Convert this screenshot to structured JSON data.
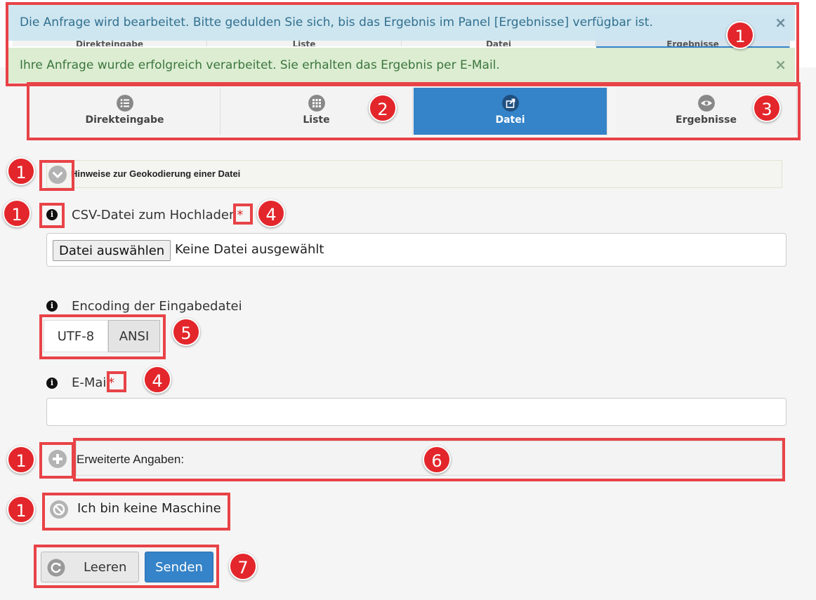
{
  "alerts": {
    "info": "Die Anfrage wird bearbeitet. Bitte gedulden Sie sich, bis das Ergebnis im Panel [Ergebnisse] verfügbar ist.",
    "success": "Ihre Anfrage wurde erfolgreich verarbeitet. Sie erhalten das Ergebnis per E-Mail.",
    "close_glyph": "×"
  },
  "tabs": [
    {
      "label": "Direkteingabe",
      "icon": "list-icon"
    },
    {
      "label": "Liste",
      "icon": "grid-icon"
    },
    {
      "label": "Datei",
      "icon": "share-icon",
      "active": true
    },
    {
      "label": "Ergebnisse",
      "icon": "eye-icon"
    }
  ],
  "hint": {
    "label": "Hinweise zur Geokodierung einer Datei"
  },
  "file": {
    "label": "CSV-Datei zum Hochladen",
    "required_mark": "*",
    "button": "Datei auswählen",
    "status": "Keine Datei ausgewählt"
  },
  "encoding": {
    "label": "Encoding der Eingabedatei",
    "options": [
      "UTF-8",
      "ANSI"
    ]
  },
  "email": {
    "label": "E-Mail",
    "required_mark": "*",
    "value": ""
  },
  "extended": {
    "label": "Erweiterte Angaben:"
  },
  "captcha": {
    "label": "Ich bin keine Maschine"
  },
  "buttons": {
    "clear": "Leeren",
    "send": "Senden"
  },
  "badges": [
    "1",
    "2",
    "3",
    "4",
    "5",
    "6",
    "7"
  ],
  "colors": {
    "accent": "#3583c8",
    "annotation": "#e3262b"
  }
}
